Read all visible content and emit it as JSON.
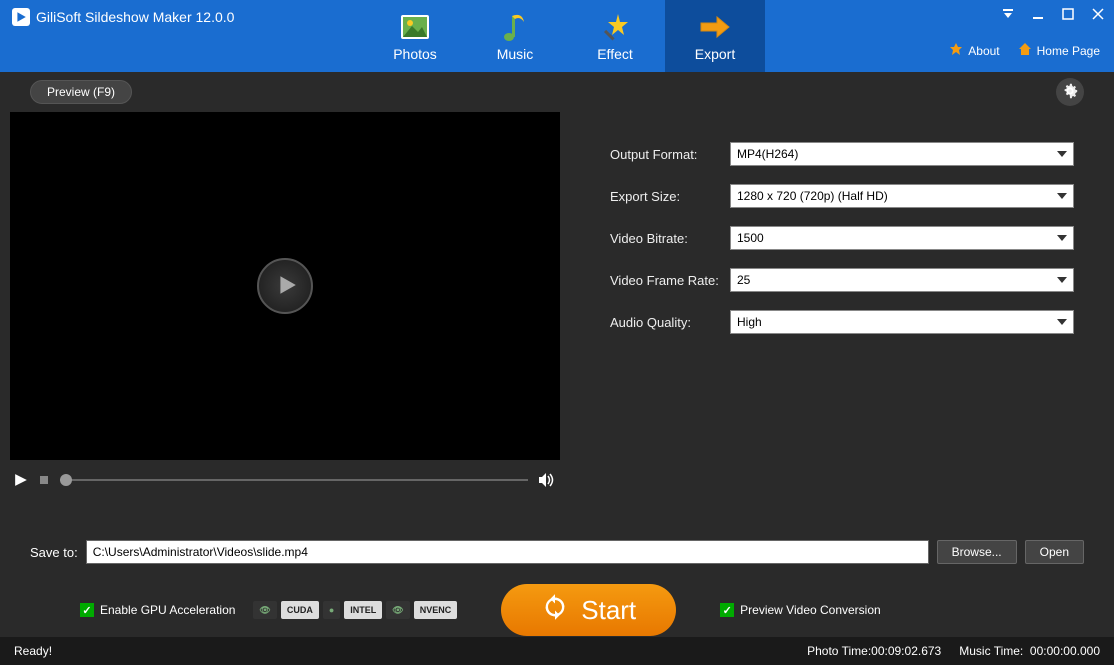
{
  "app": {
    "title": "GiliSoft Sildeshow Maker 12.0.0"
  },
  "tabs": {
    "photos": "Photos",
    "music": "Music",
    "effect": "Effect",
    "export": "Export"
  },
  "header": {
    "about": "About",
    "home": "Home Page"
  },
  "toolbar": {
    "preview": "Preview (F9)"
  },
  "form": {
    "output_format": {
      "label": "Output Format:",
      "value": "MP4(H264)"
    },
    "export_size": {
      "label": "Export Size:",
      "value": "1280 x 720 (720p) (Half HD)"
    },
    "video_bitrate": {
      "label": "Video Bitrate:",
      "value": "1500"
    },
    "frame_rate": {
      "label": "Video Frame Rate:",
      "value": "25"
    },
    "audio_quality": {
      "label": "Audio Quality:",
      "value": "High"
    }
  },
  "save": {
    "label": "Save to:",
    "path": "C:\\Users\\Administrator\\Videos\\slide.mp4",
    "browse": "Browse...",
    "open": "Open"
  },
  "options": {
    "gpu": "Enable GPU Acceleration",
    "badges": {
      "cuda": "CUDA",
      "intel": "INTEL",
      "nvenc": "NVENC"
    },
    "preview_conv": "Preview Video Conversion"
  },
  "start": "Start",
  "status": {
    "ready": "Ready!",
    "photo_time_label": "Photo Time:",
    "photo_time": "00:09:02.673",
    "music_time_label": "Music Time:",
    "music_time": "00:00:00.000"
  }
}
